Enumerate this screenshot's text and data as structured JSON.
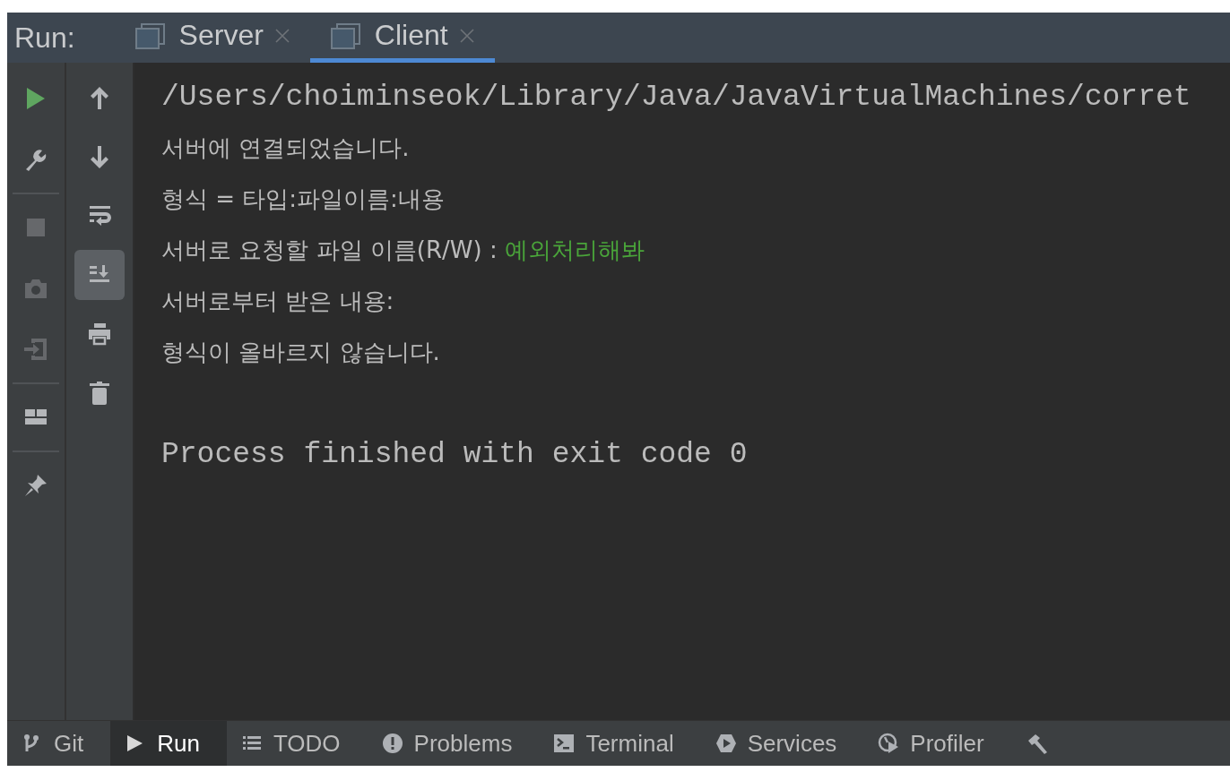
{
  "run_bar": {
    "label": "Run:",
    "tabs": [
      {
        "label": "Server",
        "selected": false
      },
      {
        "label": "Client",
        "selected": true
      }
    ]
  },
  "toolbar_left": [
    {
      "kind": "run",
      "disabled": false
    },
    {
      "kind": "wrench",
      "disabled": false
    },
    {
      "kind": "separator"
    },
    {
      "kind": "stop",
      "disabled": true
    },
    {
      "kind": "camera",
      "disabled": true
    },
    {
      "kind": "import",
      "disabled": true
    },
    {
      "kind": "separator"
    },
    {
      "kind": "layout",
      "disabled": false
    },
    {
      "kind": "separator"
    },
    {
      "kind": "pin",
      "disabled": false
    }
  ],
  "toolbar_right": [
    {
      "kind": "up",
      "selected": false
    },
    {
      "kind": "down",
      "selected": false
    },
    {
      "kind": "wrap",
      "selected": false
    },
    {
      "kind": "scroll-end",
      "selected": true
    },
    {
      "kind": "print",
      "selected": false
    },
    {
      "kind": "trash",
      "selected": false
    }
  ],
  "console": {
    "lines": [
      [
        {
          "kind": "output",
          "text": "/Users/choiminseok/Library/Java/JavaVirtualMachines/corret"
        }
      ],
      [
        {
          "kind": "output",
          "text": "서버에 연결되었습니다."
        }
      ],
      [
        {
          "kind": "output",
          "text": "형식 = 타입:파일이름:내용"
        }
      ],
      [
        {
          "kind": "output",
          "text": "서버로 요청할 파일 이름(R/W) : "
        },
        {
          "kind": "input",
          "text": "예외처리해봐"
        }
      ],
      [
        {
          "kind": "output",
          "text": "서버로부터 받은 내용:"
        }
      ],
      [
        {
          "kind": "output",
          "text": "형식이 올바르지 않습니다."
        }
      ],
      {
        "kind": "blank"
      },
      [
        {
          "kind": "output",
          "text": "Process finished with exit code 0"
        }
      ]
    ]
  },
  "bottom_bar": [
    {
      "kind": "git",
      "label": "Git",
      "selected": false
    },
    {
      "kind": "run",
      "label": "Run",
      "selected": true
    },
    {
      "kind": "todo",
      "label": "TODO",
      "selected": false
    },
    {
      "kind": "problems",
      "label": "Problems",
      "selected": false
    },
    {
      "kind": "terminal",
      "label": "Terminal",
      "selected": false
    },
    {
      "kind": "services",
      "label": "Services",
      "selected": false
    },
    {
      "kind": "profiler",
      "label": "Profiler",
      "selected": false
    },
    {
      "kind": "build",
      "selected": false
    }
  ]
}
